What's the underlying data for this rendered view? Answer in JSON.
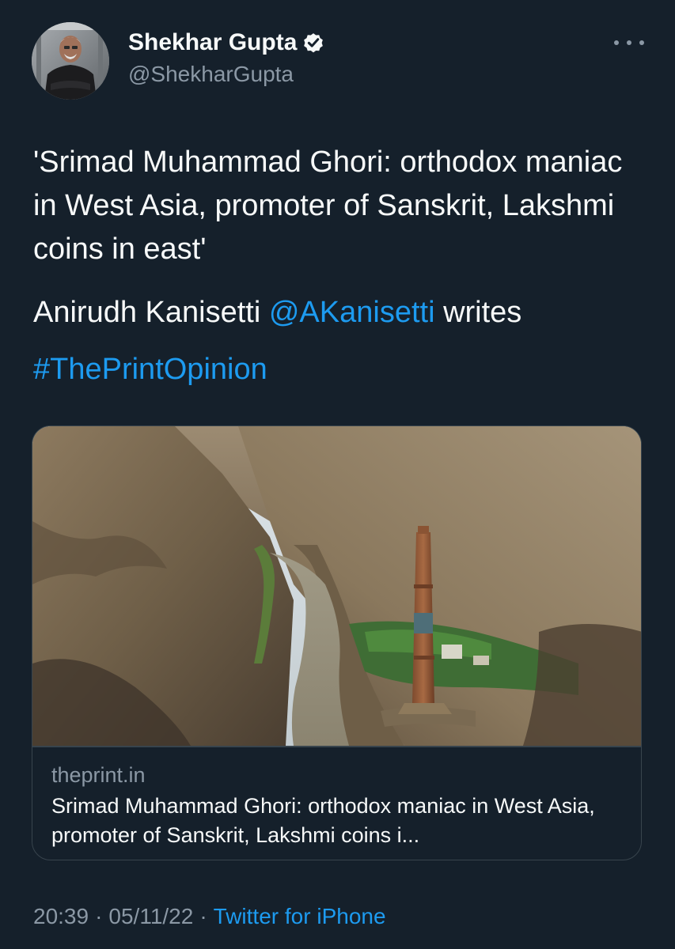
{
  "author": {
    "name": "Shekhar Gupta",
    "handle": "@ShekharGupta",
    "verified": true
  },
  "tweet": {
    "text": "'Srimad Muhammad Ghori: orthodox maniac in West Asia, promoter of Sanskrit, Lakshmi coins in east'",
    "byline_prefix": "Anirudh Kanisetti ",
    "mention": "@AKanisetti",
    "byline_suffix": " writes",
    "hashtag": "#ThePrintOpinion"
  },
  "card": {
    "domain": "theprint.in",
    "title": "Srimad Muhammad Ghori: orthodox maniac in West Asia, promoter of Sanskrit, Lakshmi coins i..."
  },
  "meta": {
    "time": "20:39",
    "date": "05/11/22",
    "separator": "·",
    "source": "Twitter for iPhone"
  },
  "colors": {
    "background": "#15202b",
    "text": "#f7f9f9",
    "secondary": "#8b98a5",
    "link": "#1d9bf0",
    "border": "#38444d"
  },
  "icons": {
    "verified": "verified-badge-icon",
    "more": "more-options-icon"
  }
}
